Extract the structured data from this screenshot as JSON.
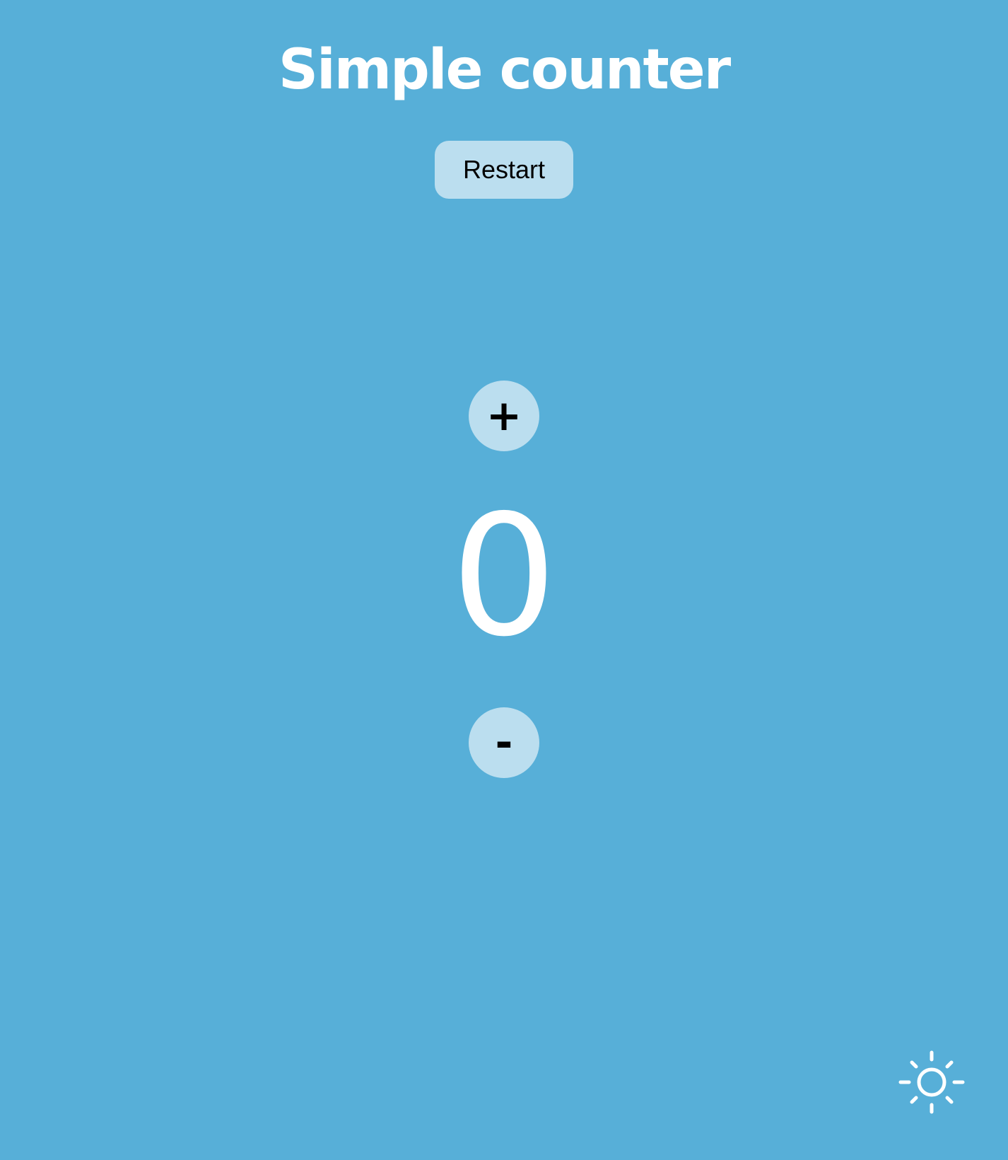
{
  "header": {
    "title": "Simple counter"
  },
  "controls": {
    "restart_label": "Restart",
    "increment_label": "+",
    "decrement_label": "-"
  },
  "counter": {
    "value": "0"
  },
  "theme_toggle": {
    "icon": "sun-icon"
  },
  "colors": {
    "background": "#57afd8",
    "button": "#bbdeef",
    "text_primary": "#ffffff",
    "button_text": "#000000"
  }
}
